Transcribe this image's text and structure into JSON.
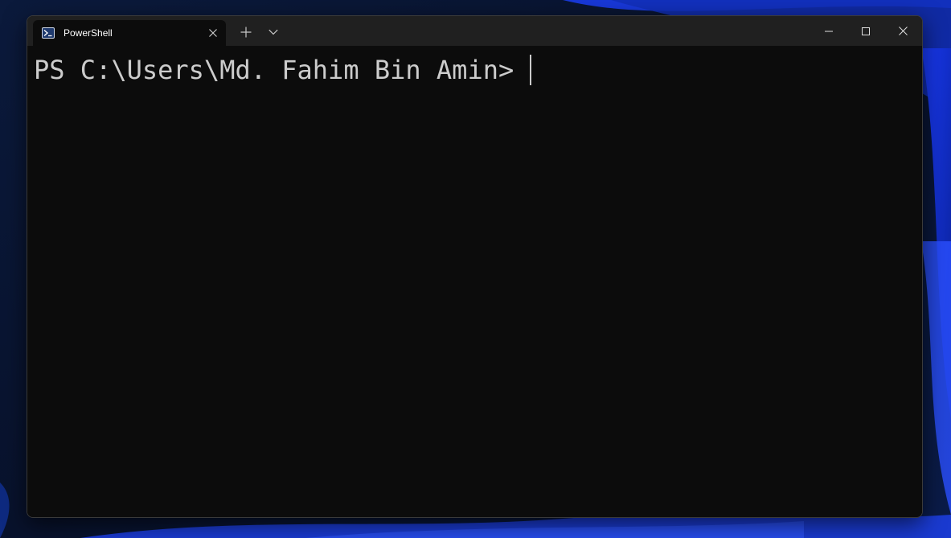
{
  "tab": {
    "title": "PowerShell",
    "icon": "powershell-icon"
  },
  "titlebar": {
    "new_tab_icon": "plus-icon",
    "dropdown_icon": "chevron-down-icon",
    "minimize_icon": "minimize-icon",
    "maximize_icon": "maximize-icon",
    "close_icon": "close-icon"
  },
  "terminal": {
    "prompt": "PS C:\\Users\\Md. Fahim Bin Amin> "
  },
  "colors": {
    "terminal_bg": "#0c0c0c",
    "titlebar_bg": "#202020",
    "text": "#cccccc",
    "wallpaper_accent": "#1f4fff"
  }
}
